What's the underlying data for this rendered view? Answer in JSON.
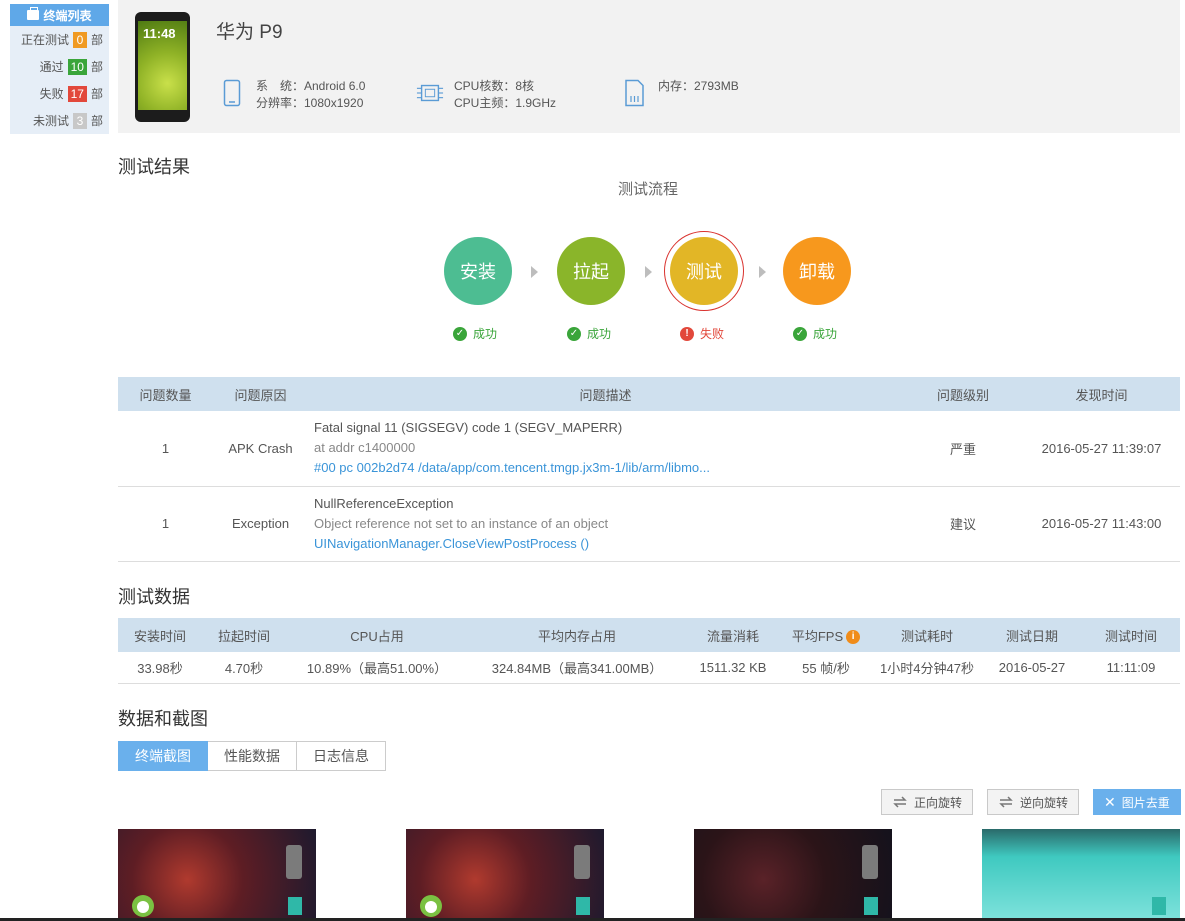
{
  "sidebar": {
    "title": "终端列表",
    "unit": "部",
    "rows": [
      {
        "label": "正在测试",
        "count": "0",
        "color": "#f09a22"
      },
      {
        "label": "通过",
        "count": "10",
        "color": "#3aa53a"
      },
      {
        "label": "失败",
        "count": "17",
        "color": "#e2483b"
      },
      {
        "label": "未测试",
        "count": "3",
        "color": "#c8c8c8"
      }
    ]
  },
  "device": {
    "name": "华为 P9",
    "clock": "11:48",
    "system_line": "系　统：Android 6.0",
    "resolution_line": "分辨率：1080x1920",
    "cpu_cores_line": "CPU核数：8核",
    "cpu_freq_line": "CPU主频：1.9GHz",
    "memory_line": "内存：2793MB",
    "icons": [
      "phone-icon",
      "cpu-icon",
      "memory-card-icon"
    ]
  },
  "results": {
    "section_title": "测试结果",
    "flow_title": "测试流程",
    "steps": [
      {
        "label": "安装",
        "status": "成功",
        "color": "#4dbd92",
        "status_color": "#3aa53a"
      },
      {
        "label": "拉起",
        "status": "成功",
        "color": "#8ab52a",
        "status_color": "#3aa53a"
      },
      {
        "label": "测试",
        "status": "失败",
        "color": "#e2b626",
        "status_color": "#e2483b"
      },
      {
        "label": "卸载",
        "status": "成功",
        "color": "#f7981d",
        "status_color": "#3aa53a"
      }
    ]
  },
  "issues": {
    "headers": [
      "问题数量",
      "问题原因",
      "问题描述",
      "问题级别",
      "发现时间"
    ],
    "rows": [
      {
        "count": "1",
        "reason": "APK Crash",
        "desc1": "Fatal signal 11 (SIGSEGV) code 1 (SEGV_MAPERR)",
        "desc2": "at addr c1400000",
        "desc3": "#00 pc 002b2d74 /data/app/com.tencent.tmgp.jx3m-1/lib/arm/libmo...",
        "level": "严重",
        "time": "2016-05-27 11:39:07"
      },
      {
        "count": "1",
        "reason": "Exception",
        "desc1": "NullReferenceException",
        "desc2": "Object reference not set to an instance of an object",
        "desc3": "UINavigationManager.CloseViewPostProcess ()",
        "level": "建议",
        "time": "2016-05-27 11:43:00"
      }
    ]
  },
  "perf": {
    "section_title": "测试数据",
    "headers": [
      "安装时间",
      "拉起时间",
      "CPU占用",
      "平均内存占用",
      "流量消耗",
      "平均FPS",
      "测试耗时",
      "测试日期",
      "测试时间"
    ],
    "values": [
      "33.98秒",
      "4.70秒",
      "10.89%（最高51.00%）",
      "324.84MB（最高341.00MB）",
      "1511.32 KB",
      "55 帧/秒",
      "1小时4分钟47秒",
      "2016-05-27",
      "11:11:09"
    ]
  },
  "screens": {
    "section_title": "数据和截图",
    "tabs": [
      "终端截图",
      "性能数据",
      "日志信息"
    ],
    "buttons": {
      "rotate_cw": "正向旋转",
      "rotate_ccw": "逆向旋转",
      "dedupe": "图片去重"
    }
  }
}
